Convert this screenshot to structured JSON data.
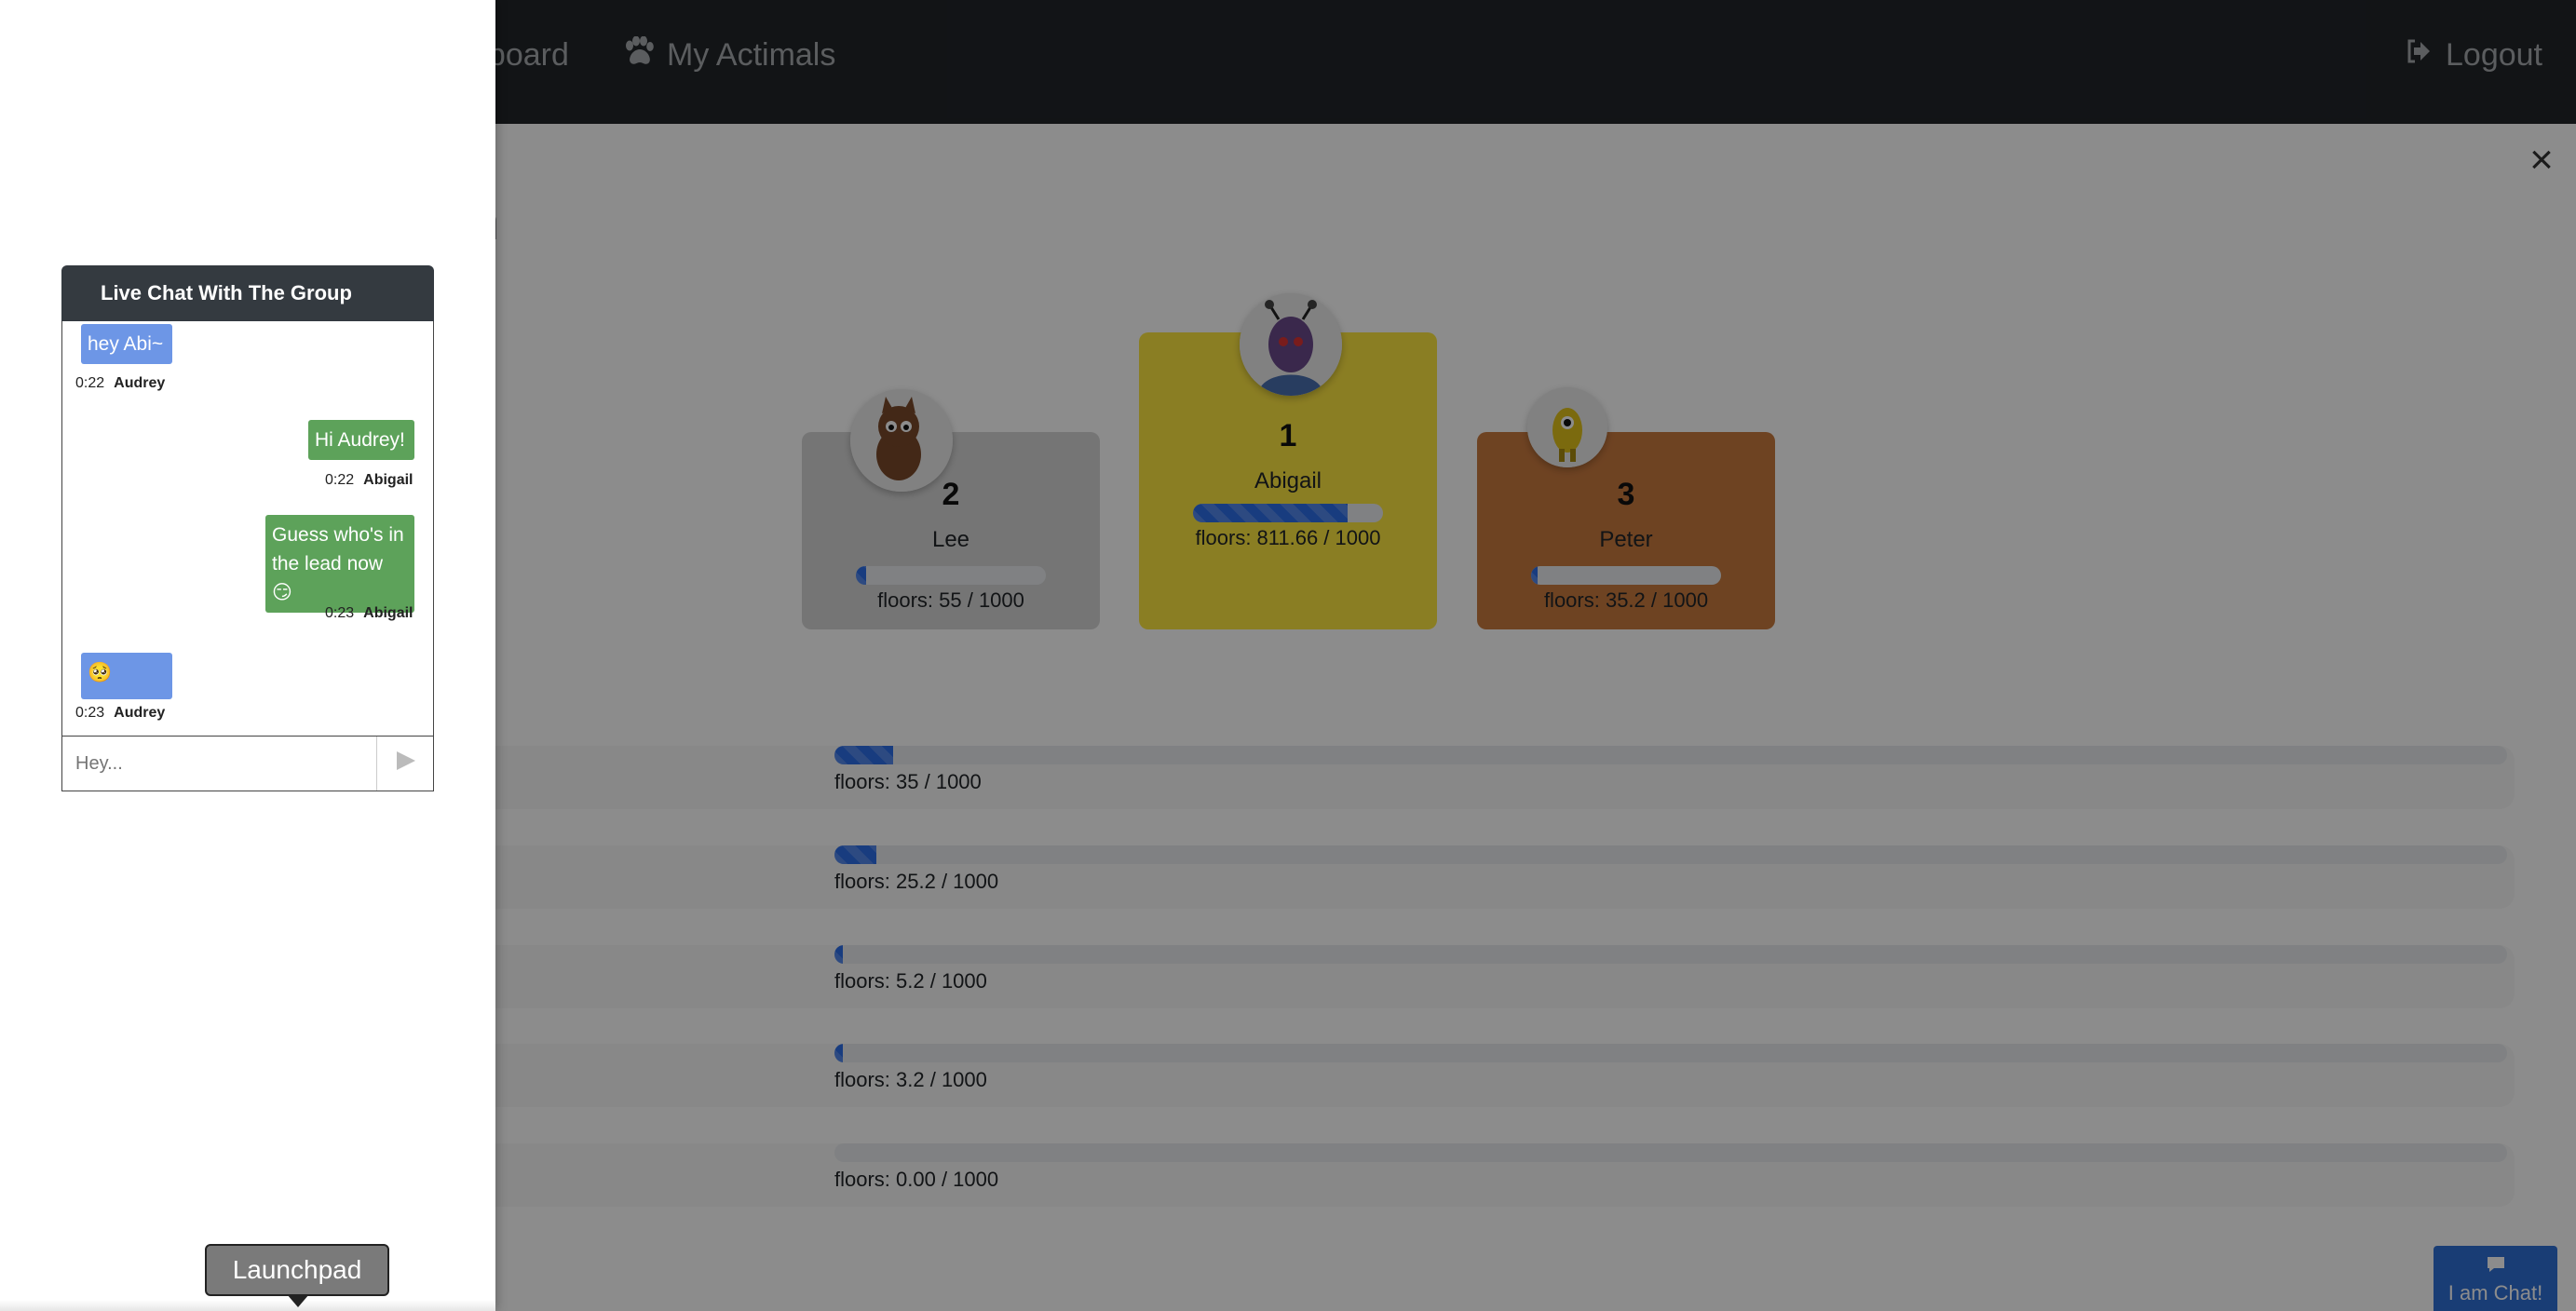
{
  "nav": {
    "dashboard_label": "hboard",
    "actimals_label": "My Actimals",
    "logout_label": "Logout"
  },
  "page": {
    "title": "n",
    "close_symbol": "×"
  },
  "podium": [
    {
      "rank": "2",
      "name": "Lee",
      "floors": "floors: 55 / 1000",
      "progress": 0.055,
      "color": "#d6d6d6"
    },
    {
      "rank": "1",
      "name": "Abigail",
      "floors": "floors: 811.66 / 1000",
      "progress": 0.8117,
      "color": "#fce541"
    },
    {
      "rank": "3",
      "name": "Peter",
      "floors": "floors: 35.2 / 1000",
      "progress": 0.0352,
      "color": "#c97a3f"
    }
  ],
  "rows": [
    {
      "floors": "floors: 35 / 1000",
      "progress": 0.035
    },
    {
      "floors": "floors: 25.2 / 1000",
      "progress": 0.0252
    },
    {
      "floors": "floors: 5.2 / 1000",
      "progress": 0.0052
    },
    {
      "floors": "floors: 3.2 / 1000",
      "progress": 0.0032
    },
    {
      "floors": "floors: 0.00 / 1000",
      "progress": 0
    }
  ],
  "chat_widget": {
    "label": "I am Chat!"
  },
  "chat": {
    "title": "Live Chat With The Group",
    "placeholder": "Hey...",
    "messages": [
      {
        "text": "hey Abi~",
        "time": "0:22",
        "author": "Audrey"
      },
      {
        "text": "Hi Audrey!",
        "time": "0:22",
        "author": "Abigail"
      },
      {
        "text": "Guess who's in the lead now 😏",
        "time": "0:23",
        "author": "Abigail"
      },
      {
        "text": "🥺",
        "time": "0:23",
        "author": "Audrey"
      }
    ]
  },
  "tooltip": {
    "label": "Launchpad"
  },
  "colors": {
    "navbar": "#212529",
    "chat_in": "#6d96e6",
    "chat_out": "#5da25a",
    "progress": "#2d6ee8"
  }
}
